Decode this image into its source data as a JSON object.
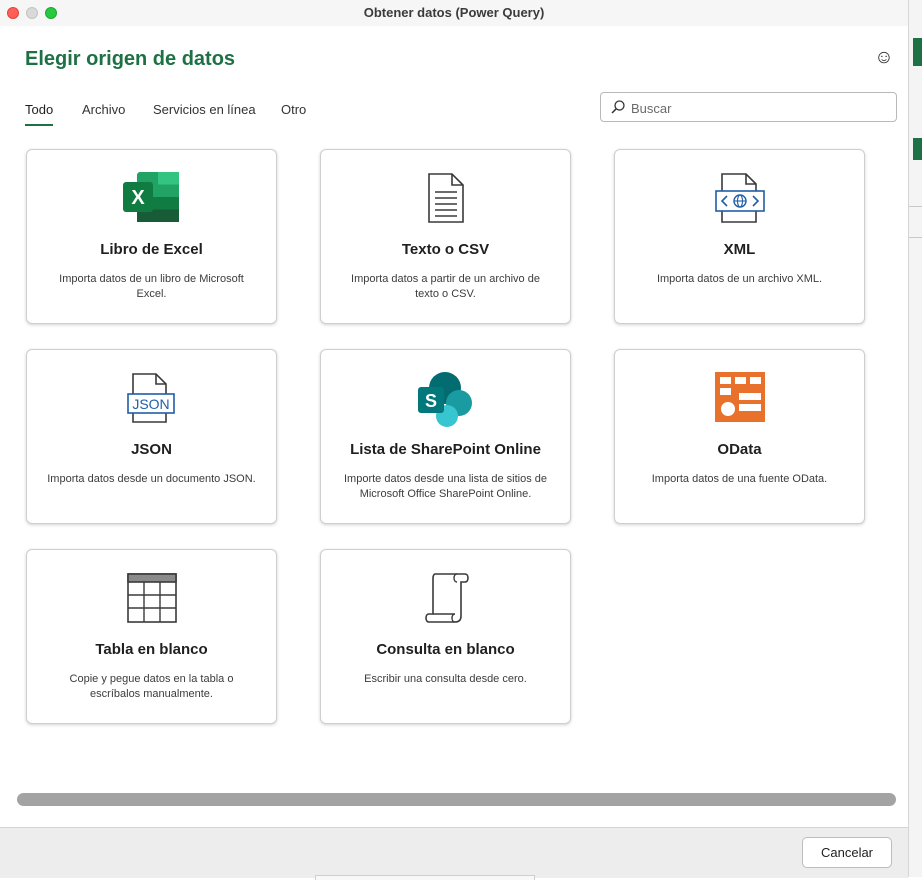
{
  "window": {
    "title": "Obtener datos (Power Query)"
  },
  "header": {
    "title": "Elegir origen de datos",
    "feedback_icon": "smiley-icon"
  },
  "tabs": [
    {
      "label": "Todo",
      "active": true
    },
    {
      "label": "Archivo",
      "active": false
    },
    {
      "label": "Servicios en línea",
      "active": false
    },
    {
      "label": "Otro",
      "active": false
    }
  ],
  "search": {
    "placeholder": "Buscar",
    "value": ""
  },
  "cards": [
    {
      "title": "Libro de Excel",
      "description": "Importa datos de un libro de Microsoft Excel.",
      "icon": "excel-icon"
    },
    {
      "title": "Texto o CSV",
      "description": "Importa datos a partir de un archivo de texto o CSV.",
      "icon": "text-file-icon"
    },
    {
      "title": "XML",
      "description": "Importa datos de un archivo XML.",
      "icon": "xml-icon"
    },
    {
      "title": "JSON",
      "description": "Importa datos desde un documento JSON.",
      "icon": "json-icon"
    },
    {
      "title": "Lista de SharePoint Online",
      "description": "Importe datos desde una lista de sitios de Microsoft Office SharePoint Online.",
      "icon": "sharepoint-icon"
    },
    {
      "title": "OData",
      "description": "Importa datos de una fuente OData.",
      "icon": "odata-icon"
    },
    {
      "title": "Tabla en blanco",
      "description": "Copie y pegue datos en la tabla o escríbalos manualmente.",
      "icon": "blank-table-icon"
    },
    {
      "title": "Consulta en blanco",
      "description": "Escribir una consulta desde cero.",
      "icon": "blank-query-icon"
    }
  ],
  "icon_text": {
    "excel_letter": "X",
    "json_label": "JSON",
    "sharepoint_letter": "S"
  },
  "footer": {
    "cancel_label": "Cancelar"
  },
  "colors": {
    "accent": "#1e7145",
    "excel": "#1e7145",
    "odata": "#e8712b",
    "sharepoint": "#036c70"
  }
}
